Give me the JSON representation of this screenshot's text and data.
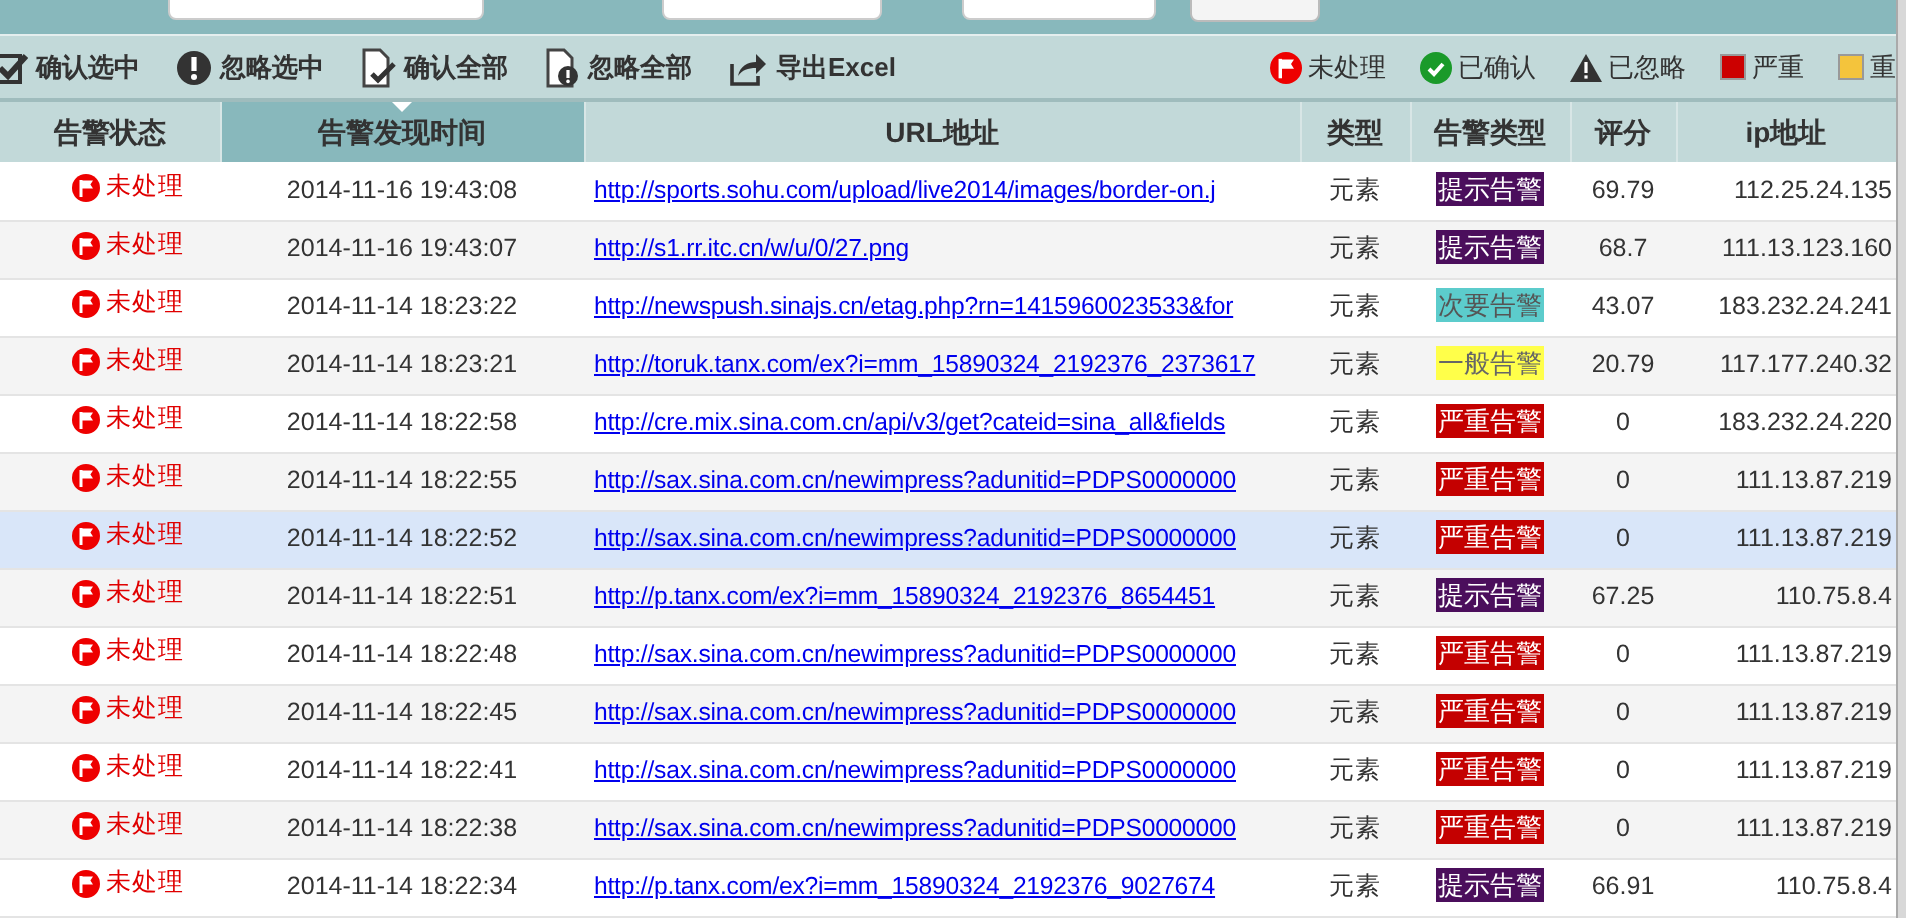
{
  "toolbar": {
    "actions": [
      {
        "kind": "confirm-selected",
        "label": "确认选中"
      },
      {
        "kind": "ignore-selected",
        "label": "忽略选中"
      },
      {
        "kind": "confirm-all",
        "label": "确认全部"
      },
      {
        "kind": "ignore-all",
        "label": "忽略全部"
      },
      {
        "kind": "export",
        "label": "导出Excel"
      }
    ],
    "legend": [
      {
        "kind": "pending",
        "label": "未处理"
      },
      {
        "kind": "confirmed",
        "label": "已确认"
      },
      {
        "kind": "ignored",
        "label": "已忽略"
      },
      {
        "kind": "swatch",
        "color": "#cc0000",
        "label": "严重"
      },
      {
        "kind": "swatch",
        "color": "#f4c43c",
        "label": "重"
      }
    ]
  },
  "table": {
    "columns": [
      {
        "label": "告警状态",
        "sorted": false
      },
      {
        "label": "告警发现时间",
        "sorted": true
      },
      {
        "label": "URL地址",
        "sorted": false
      },
      {
        "label": "类型",
        "sorted": false
      },
      {
        "label": "告警类型",
        "sorted": false
      },
      {
        "label": "评分",
        "sorted": false
      },
      {
        "label": "ip地址",
        "sorted": false
      }
    ],
    "rows": [
      {
        "selected": false,
        "status": "未处理",
        "time": "2014-11-16 19:43:08",
        "url": "http://sports.sohu.com/upload/live2014/images/border-on.j",
        "type": "元素",
        "alert": {
          "kind": "hint",
          "label": "提示告警"
        },
        "score": "69.79",
        "ip": "112.25.24.135"
      },
      {
        "selected": false,
        "status": "未处理",
        "time": "2014-11-16 19:43:07",
        "url": "http://s1.rr.itc.cn/w/u/0/27.png",
        "type": "元素",
        "alert": {
          "kind": "hint",
          "label": "提示告警"
        },
        "score": "68.7",
        "ip": "111.13.123.160"
      },
      {
        "selected": false,
        "status": "未处理",
        "time": "2014-11-14 18:23:22",
        "url": "http://newspush.sinajs.cn/etag.php?rn=1415960023533&for",
        "type": "元素",
        "alert": {
          "kind": "minor",
          "label": "次要告警"
        },
        "score": "43.07",
        "ip": "183.232.24.241"
      },
      {
        "selected": false,
        "status": "未处理",
        "time": "2014-11-14 18:23:21",
        "url": "http://toruk.tanx.com/ex?i=mm_15890324_2192376_2373617",
        "type": "元素",
        "alert": {
          "kind": "general",
          "label": "一般告警"
        },
        "score": "20.79",
        "ip": "117.177.240.32"
      },
      {
        "selected": false,
        "status": "未处理",
        "time": "2014-11-14 18:22:58",
        "url": "http://cre.mix.sina.com.cn/api/v3/get?cateid=sina_all&fields",
        "type": "元素",
        "alert": {
          "kind": "severe",
          "label": "严重告警"
        },
        "score": "0",
        "ip": "183.232.24.220"
      },
      {
        "selected": false,
        "status": "未处理",
        "time": "2014-11-14 18:22:55",
        "url": "http://sax.sina.com.cn/newimpress?adunitid=PDPS0000000",
        "type": "元素",
        "alert": {
          "kind": "severe",
          "label": "严重告警"
        },
        "score": "0",
        "ip": "111.13.87.219"
      },
      {
        "selected": true,
        "status": "未处理",
        "time": "2014-11-14 18:22:52",
        "url": "http://sax.sina.com.cn/newimpress?adunitid=PDPS0000000",
        "type": "元素",
        "alert": {
          "kind": "severe",
          "label": "严重告警"
        },
        "score": "0",
        "ip": "111.13.87.219"
      },
      {
        "selected": false,
        "status": "未处理",
        "time": "2014-11-14 18:22:51",
        "url": "http://p.tanx.com/ex?i=mm_15890324_2192376_8654451",
        "type": "元素",
        "alert": {
          "kind": "hint",
          "label": "提示告警"
        },
        "score": "67.25",
        "ip": "110.75.8.4"
      },
      {
        "selected": false,
        "status": "未处理",
        "time": "2014-11-14 18:22:48",
        "url": "http://sax.sina.com.cn/newimpress?adunitid=PDPS0000000",
        "type": "元素",
        "alert": {
          "kind": "severe",
          "label": "严重告警"
        },
        "score": "0",
        "ip": "111.13.87.219"
      },
      {
        "selected": false,
        "status": "未处理",
        "time": "2014-11-14 18:22:45",
        "url": "http://sax.sina.com.cn/newimpress?adunitid=PDPS0000000",
        "type": "元素",
        "alert": {
          "kind": "severe",
          "label": "严重告警"
        },
        "score": "0",
        "ip": "111.13.87.219"
      },
      {
        "selected": false,
        "status": "未处理",
        "time": "2014-11-14 18:22:41",
        "url": "http://sax.sina.com.cn/newimpress?adunitid=PDPS0000000",
        "type": "元素",
        "alert": {
          "kind": "severe",
          "label": "严重告警"
        },
        "score": "0",
        "ip": "111.13.87.219"
      },
      {
        "selected": false,
        "status": "未处理",
        "time": "2014-11-14 18:22:38",
        "url": "http://sax.sina.com.cn/newimpress?adunitid=PDPS0000000",
        "type": "元素",
        "alert": {
          "kind": "severe",
          "label": "严重告警"
        },
        "score": "0",
        "ip": "111.13.87.219"
      },
      {
        "selected": false,
        "status": "未处理",
        "time": "2014-11-14 18:22:34",
        "url": "http://p.tanx.com/ex?i=mm_15890324_2192376_9027674",
        "type": "元素",
        "alert": {
          "kind": "hint",
          "label": "提示告警"
        },
        "score": "66.91",
        "ip": "110.75.8.4"
      }
    ]
  }
}
